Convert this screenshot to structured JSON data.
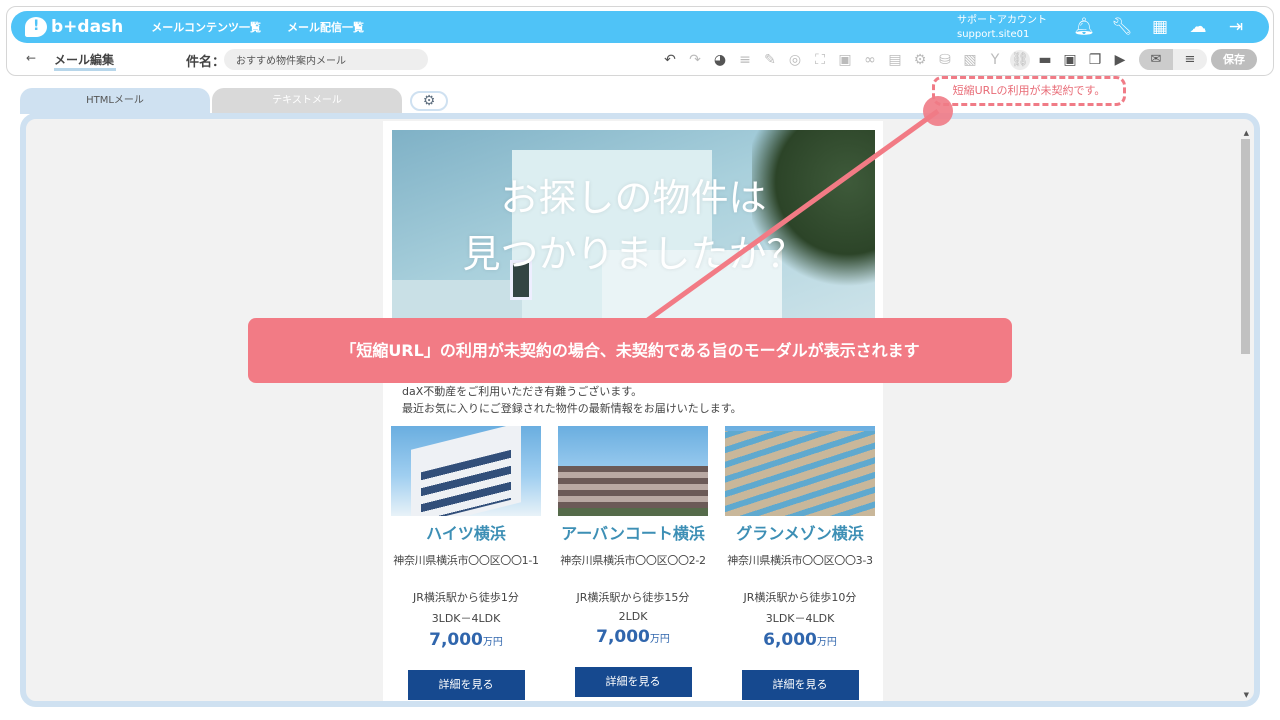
{
  "app": {
    "logo_text": "b+dash",
    "nav": [
      "メールコンテンツ一覧",
      "メール配信一覧"
    ]
  },
  "account": {
    "label": "サポートアカウント",
    "site": "support.site01"
  },
  "top_icons": [
    "bell-icon",
    "wrench-icon",
    "grid-icon",
    "chat-icon",
    "logout-icon"
  ],
  "subbar": {
    "back": "←",
    "title": "メール編集",
    "subject_label": "件名：",
    "subject_value": "おすすめ物件案内メール",
    "save": "保存"
  },
  "notice": "短縮URLの利用が未契約です。",
  "tabs": {
    "html": "HTMLメール",
    "text": "テキストメール"
  },
  "hero": {
    "line1": "お探しの物件は",
    "line2": "見つかりましたか？"
  },
  "greeting": {
    "line1": "daX不動産をご利用いただき有難うございます。",
    "line2": "最近お気に入りにご登録された物件の最新情報をお届けいたします。"
  },
  "cards": [
    {
      "name": "ハイツ横浜",
      "address": "神奈川県横浜市〇〇区〇〇1-1",
      "access": "JR横浜駅から徒歩1分",
      "layout": "3LDK－4LDK",
      "price": "7,000",
      "unit": "万円",
      "button": "詳細を見る"
    },
    {
      "name": "アーバンコート横浜",
      "address": "神奈川県横浜市〇〇区〇〇2-2",
      "access": "JR横浜駅から徒歩15分",
      "layout": "2LDK",
      "price": "7,000",
      "unit": "万円",
      "button": "詳細を見る"
    },
    {
      "name": "グランメゾン横浜",
      "address": "神奈川県横浜市〇〇区〇〇3-3",
      "access": "JR横浜駅から徒歩10分",
      "layout": "3LDK－4LDK",
      "price": "6,000",
      "unit": "万円",
      "button": "詳細を見る"
    }
  ],
  "callout": "「短縮URL」の利用が未契約の場合、未契約である旨のモーダルが表示されます",
  "colors": {
    "brand": "#4fc3f7",
    "accent": "#f27b85",
    "button": "#16498f",
    "price": "#3066ad",
    "name": "#3d8fb5"
  }
}
